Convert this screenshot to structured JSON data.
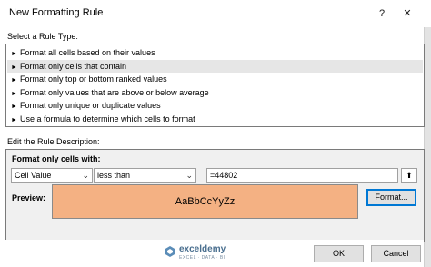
{
  "window": {
    "title": "New Formatting Rule",
    "help_label": "?",
    "close_label": "✕"
  },
  "rule_type": {
    "label": "Select a Rule Type:",
    "items": [
      {
        "label": "Format all cells based on their values"
      },
      {
        "label": "Format only cells that contain"
      },
      {
        "label": "Format only top or bottom ranked values"
      },
      {
        "label": "Format only values that are above or below average"
      },
      {
        "label": "Format only unique or duplicate values"
      },
      {
        "label": "Use a formula to determine which cells to format"
      }
    ],
    "selected_index": 1,
    "arrow": "►"
  },
  "description": {
    "label": "Edit the Rule Description:",
    "sub_label": "Format only cells with:",
    "field1": "Cell Value",
    "field2": "less than",
    "value": "=44802",
    "preview_label": "Preview:",
    "preview_text": "AaBbCcYyZz",
    "format_button": "Format..."
  },
  "watermark": {
    "name": "exceldemy",
    "tagline": "EXCEL · DATA · BI"
  },
  "buttons": {
    "ok": "OK",
    "cancel": "Cancel"
  },
  "colors": {
    "preview_fill": "#f4b183",
    "selected_row": "#e6e6e6",
    "focus_border": "#0078d4"
  }
}
